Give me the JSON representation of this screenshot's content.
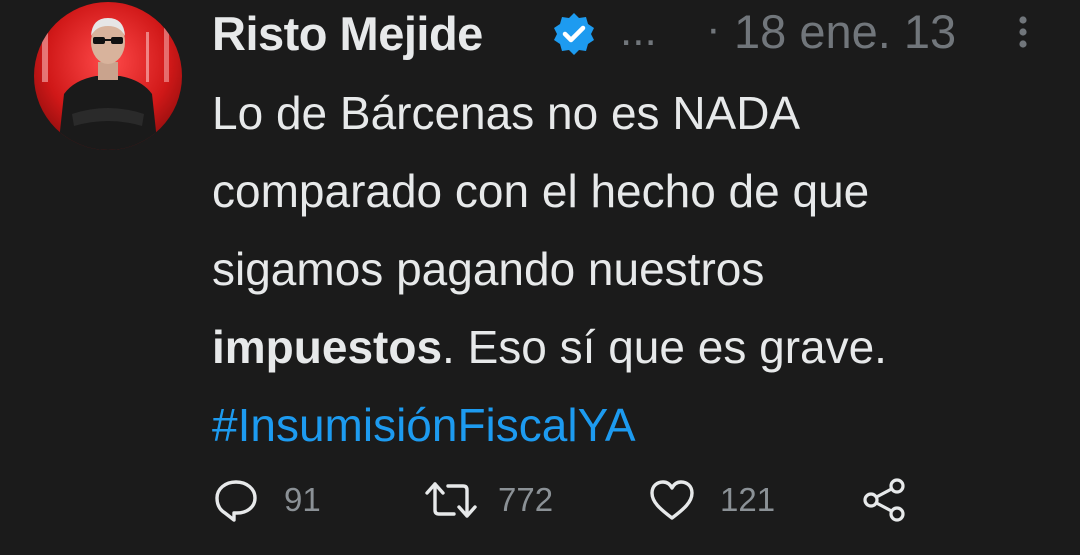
{
  "author": {
    "display_name": "Risto Mejide",
    "verified": true,
    "handle_truncated": "...",
    "separator": "·",
    "date": "18 ene. 13"
  },
  "tweet": {
    "line1": "Lo de Bárcenas no es NADA",
    "line2": "comparado con el hecho de que",
    "line3": "sigamos pagando nuestros",
    "line4_bold": "impuestos",
    "line4_rest": ". Eso sí que es grave.",
    "hashtag": "#InsumisiónFiscalYA"
  },
  "actions": {
    "replies": "91",
    "retweets": "772",
    "likes": "121"
  },
  "colors": {
    "background": "#1b1b1b",
    "text": "#e7e9ea",
    "secondary": "#71767b",
    "accent": "#1d9bf0",
    "verified": "#1d9bf0"
  },
  "icons": [
    "verified-badge-icon",
    "more-options-icon",
    "reply-icon",
    "retweet-icon",
    "like-icon",
    "share-icon"
  ]
}
